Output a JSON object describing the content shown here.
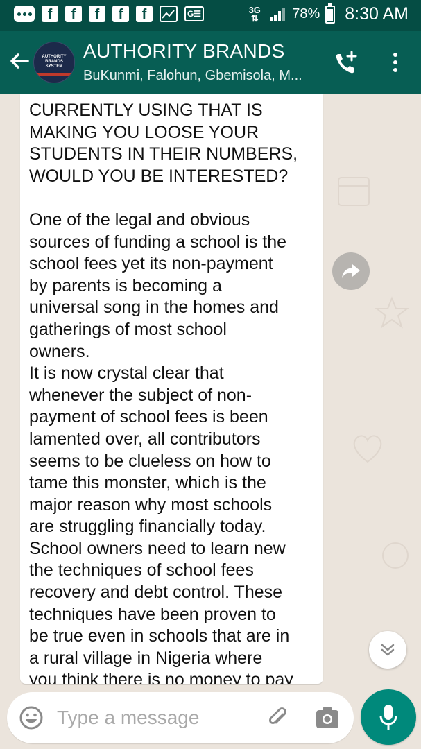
{
  "status_bar": {
    "network": "3G",
    "battery_percent": "78%",
    "battery_level": 0.78,
    "time": "8:30 AM",
    "notification_icons": [
      "more-dots-icon",
      "facebook-icon",
      "facebook-icon",
      "facebook-icon",
      "facebook-icon",
      "facebook-icon",
      "gallery-icon",
      "ge-icon"
    ]
  },
  "header": {
    "title": "AUTHORITY BRANDS",
    "subtitle": "BuKunmi, Falohun, Gbemisola, M...",
    "avatar_text": "AUTHORITY BRANDS SYSTEM"
  },
  "message": {
    "text": "CURRENTLY USING THAT IS\nMAKING YOU LOOSE YOUR\nSTUDENTS IN THEIR NUMBERS,\nWOULD YOU BE INTERESTED?\n\nOne of the legal and obvious\nsources of funding a school is the\nschool fees yet its non-payment\nby parents is becoming a\nuniversal song in the homes and\ngatherings of most school\nowners.\nIt is now crystal clear that\nwhenever the subject of non-\npayment of school fees is been\nlamented over, all contributors\nseems to be clueless on how to\ntame this monster, which is the\nmajor reason why most schools\nare struggling financially today.\nSchool owners need to learn new\nthe techniques of school fees\nrecovery and debt control. These\ntechniques have been proven to\nbe true even in schools that are in\na rural village in Nigeria where\nyou think there is no money to pay"
  },
  "composer": {
    "placeholder": "Type a message"
  },
  "colors": {
    "status_bar": "#054d44",
    "header": "#075e54",
    "accent": "#00897b",
    "chat_background": "#ebe4dc"
  }
}
